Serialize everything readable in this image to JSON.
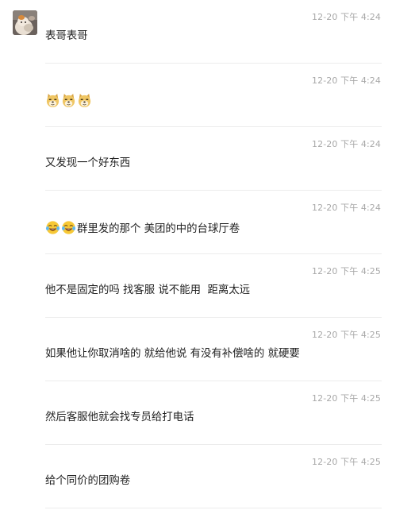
{
  "chat": {
    "messages": [
      {
        "time": "12-20 下午 4:24",
        "text": "表哥表哥"
      },
      {
        "time": "12-20 下午 4:24",
        "text": "",
        "emojis": [
          "doge",
          "doge",
          "doge"
        ]
      },
      {
        "time": "12-20 下午 4:24",
        "text": "又发现一个好东西"
      },
      {
        "time": "12-20 下午 4:24",
        "text": "群里发的那个 美团的中的台球厅卷",
        "emojis": [
          "tears-of-joy",
          "tears-of-joy"
        ]
      },
      {
        "time": "12-20 下午 4:25",
        "text": "他不是固定的吗 找客服 说不能用  距离太远"
      },
      {
        "time": "12-20 下午 4:25",
        "text": "如果他让你取消啥的 就给他说 有没有补偿啥的 就硬要"
      },
      {
        "time": "12-20 下午 4:25",
        "text": "然后客服他就会找专员给打电话"
      },
      {
        "time": "12-20 下午 4:25",
        "text": "给个同价的团购卷"
      }
    ]
  }
}
